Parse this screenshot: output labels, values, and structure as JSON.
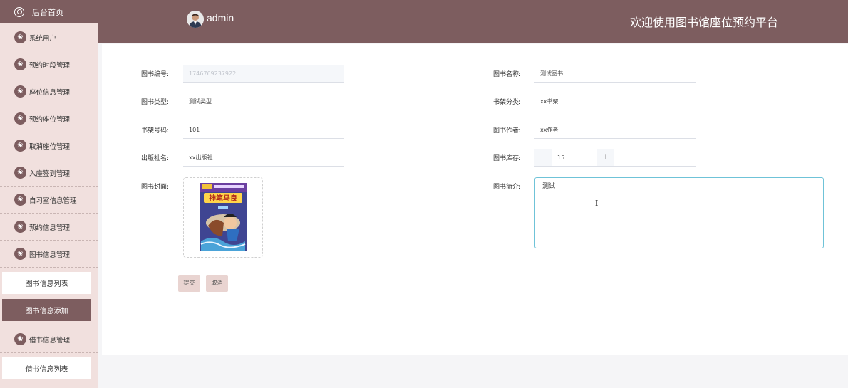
{
  "sidebar": {
    "home": "后台首页",
    "items": [
      {
        "label": "系统用户"
      },
      {
        "label": "预约时段管理"
      },
      {
        "label": "座位信息管理"
      },
      {
        "label": "预约座位管理"
      },
      {
        "label": "取消座位管理"
      },
      {
        "label": "入座签到管理"
      },
      {
        "label": "自习室信息管理"
      },
      {
        "label": "预约信息管理"
      },
      {
        "label": "图书信息管理"
      },
      {
        "label": "借书信息管理"
      }
    ],
    "book_sub": [
      {
        "label": "图书信息列表",
        "active": false
      },
      {
        "label": "图书信息添加",
        "active": true
      }
    ],
    "borrow_sub": [
      {
        "label": "借书信息列表",
        "active": false
      }
    ]
  },
  "header": {
    "username": "admin",
    "welcome": "欢迎使用图书馆座位预约平台"
  },
  "form": {
    "book_no": {
      "label": "图书编号:",
      "value": "1746769237922"
    },
    "book_name": {
      "label": "图书名称:",
      "value": "测试图书"
    },
    "book_type": {
      "label": "图书类型:",
      "value": "测试类型"
    },
    "shelf_category": {
      "label": "书架分类:",
      "value": "xx书架"
    },
    "shelf_no": {
      "label": "书架号码:",
      "value": "101"
    },
    "author": {
      "label": "图书作者:",
      "value": "xx作者"
    },
    "publisher": {
      "label": "出版社名:",
      "value": "xx出版社"
    },
    "stock": {
      "label": "图书库存:",
      "value": "15",
      "minus": "−",
      "plus": "+"
    },
    "cover": {
      "label": "图书封面:",
      "title": "神笔马良"
    },
    "intro": {
      "label": "图书简介:",
      "value": "测试"
    },
    "submit": "提交",
    "cancel": "取消"
  },
  "colors": {
    "primary": "#7d5d5f",
    "sidebar_bg": "#f1e0de",
    "button_bg": "#e9d4d1",
    "focus_border": "#6fc3d8"
  }
}
